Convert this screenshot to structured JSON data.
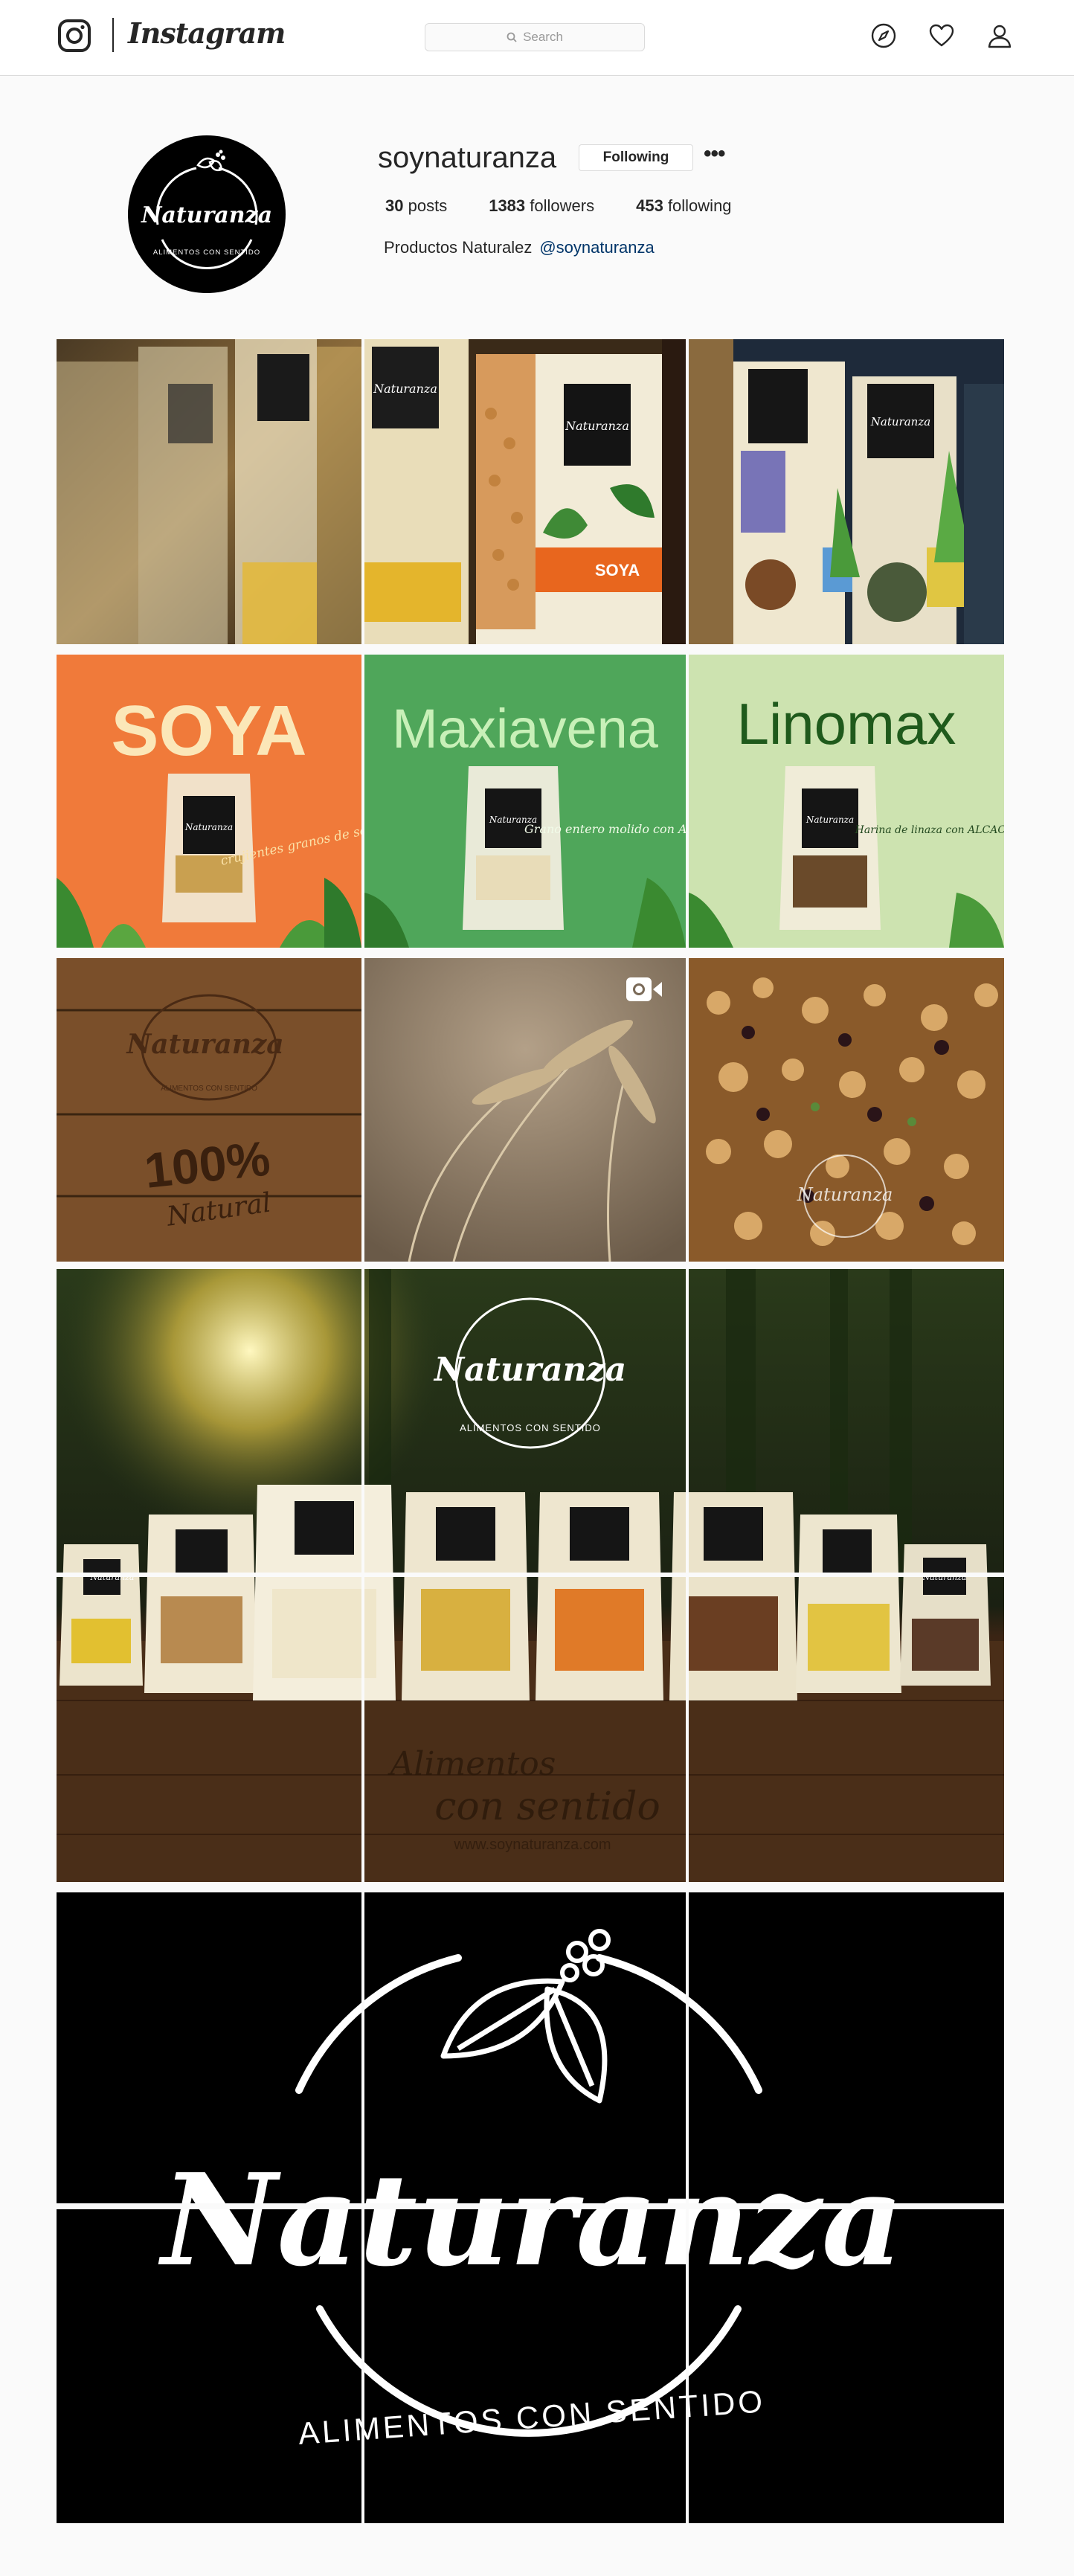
{
  "nav": {
    "brand": "Instagram",
    "search_placeholder": "Search",
    "icons": [
      "instagram-camera-icon",
      "compass-icon",
      "heart-icon",
      "user-icon"
    ]
  },
  "profile": {
    "username": "soynaturanza",
    "follow_button": "Following",
    "more": "•••",
    "posts_count": "30",
    "posts_label": "posts",
    "followers_count": "1383",
    "followers_label": "followers",
    "following_count": "453",
    "following_label": "following",
    "bio_name": "Productos Naturalez",
    "bio_handle": "@soynaturanza",
    "avatar_logo": "Naturanza",
    "avatar_tagline": "ALIMENTOS CON SENTIDO"
  },
  "posts": {
    "soya_title": "SOYA",
    "soya_caption": "crujientes granos de soya",
    "maxiavena_title": "Maxiavena",
    "maxiavena_caption": "Grano entero molido con ALOE",
    "linomax_title": "Linomax",
    "linomax_caption": "Harina de linaza con ALCACHOFA",
    "wood_logo": "Naturanza",
    "wood_tagline": "ALIMENTOS CON SENTIDO",
    "wood_claim": "100%",
    "wood_claim2": "Natural",
    "panorama_logo": "Naturanza",
    "panorama_tagline": "ALIMENTOS CON SENTIDO",
    "panorama_slogan1": "Alimentos",
    "panorama_slogan2": "con sentido",
    "panorama_url": "www.soynaturanza.com",
    "logo_brand": "Naturanza",
    "logo_tagline": "ALIMENTOS CON SENTIDO",
    "packs": [
      "Naturanza",
      "Naturanza",
      "Naturanza",
      "Naturanza",
      "Naturanza",
      "Naturanza",
      "Naturanza",
      "Naturanza"
    ]
  },
  "colors": {
    "soya_bg": "#f07a3a",
    "maxiavena_bg": "#4fa65a",
    "linomax_bg": "#cde3b0",
    "link": "#003569"
  }
}
